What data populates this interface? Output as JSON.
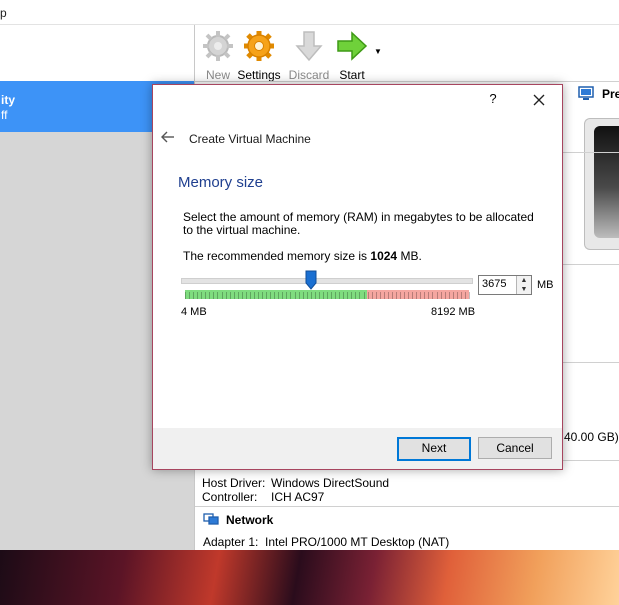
{
  "menubar": {
    "fragment": "p"
  },
  "vm": {
    "name_fragment": "ity",
    "state_fragment": "ff"
  },
  "toolbar": {
    "new_label": "New",
    "settings_label": "Settings",
    "discard_label": "Discard",
    "start_label": "Start"
  },
  "details": {
    "preview_fragment": "Pre",
    "storage_size_fragment": "40.00 GB)",
    "audio": {
      "host_driver_key": "Host Driver:",
      "host_driver_value": "Windows DirectSound",
      "controller_key": "Controller:",
      "controller_value": "ICH AC97"
    },
    "network_heading": "Network",
    "adapter_key": "Adapter 1:",
    "adapter_value": "Intel PRO/1000 MT Desktop (NAT)"
  },
  "dialog": {
    "help": "?",
    "title": "Create Virtual Machine",
    "section_title": "Memory size",
    "description": "Select the amount of memory (RAM) in megabytes to be allocated to the virtual machine.",
    "recommend_prefix": "The recommended memory size is ",
    "recommend_value": "1024",
    "recommend_suffix": " MB.",
    "min_label": "4 MB",
    "max_label": "8192 MB",
    "memory_value": "3675",
    "unit": "MB",
    "next_label": "Next",
    "cancel_label": "Cancel",
    "slider": {
      "min": 4,
      "max": 8192,
      "value": 3675
    }
  },
  "colors": {
    "selection": "#3d93f7",
    "section_title": "#1f3f8f",
    "scale_green": "#7fdc7f",
    "scale_red": "#f5a6a0",
    "thumb": "#1a6fd1"
  }
}
